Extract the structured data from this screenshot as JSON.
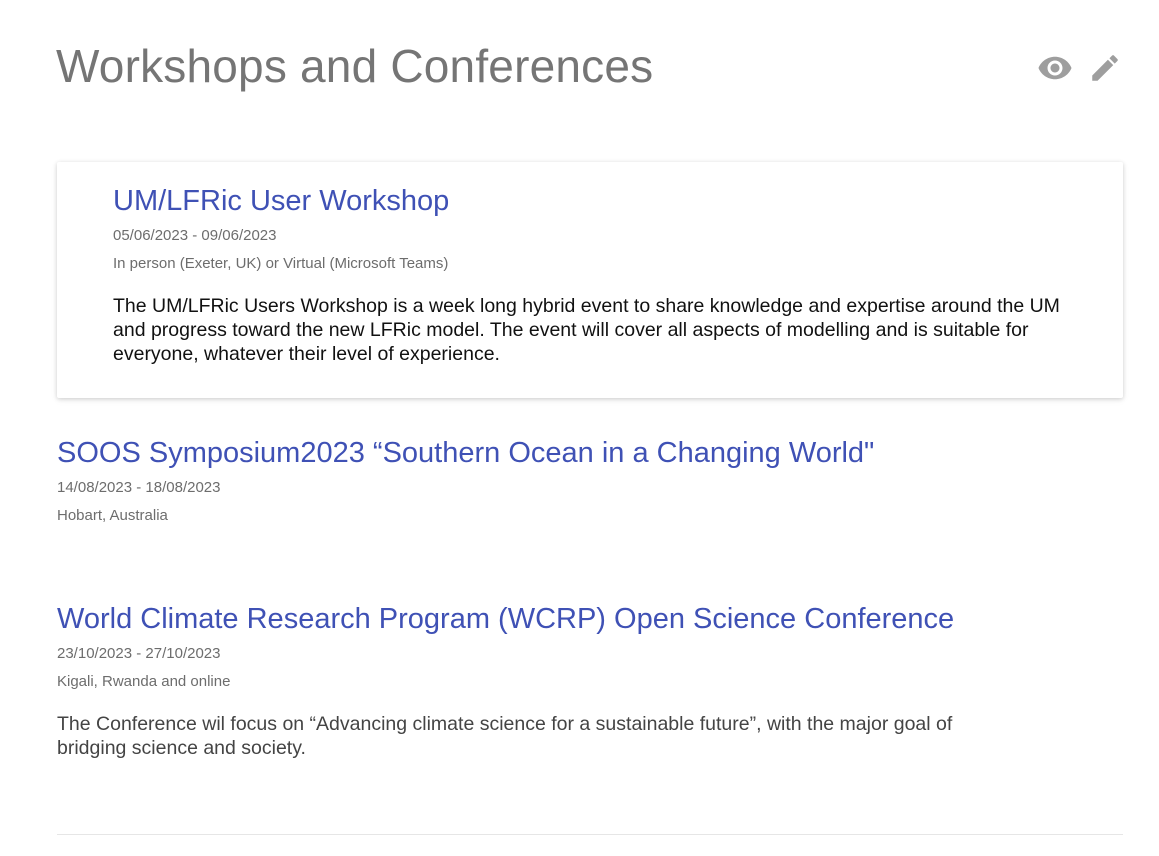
{
  "header": {
    "title": "Workshops and Conferences",
    "view_icon": "eye-icon",
    "edit_icon": "pencil-icon"
  },
  "events": [
    {
      "title": "UM/LFRic User Workshop",
      "dates": "05/06/2023 - 09/06/2023",
      "location": "In person (Exeter, UK) or Virtual (Microsoft Teams)",
      "description": "The UM/LFRic Users Workshop is a week long hybrid event to share knowledge and expertise around the UM and progress toward the new LFRic model. The event will cover all aspects of modelling and is suitable for everyone, whatever their level of experience."
    },
    {
      "title": "SOOS Symposium2023 “Southern Ocean in a Changing World\"",
      "dates": "14/08/2023 - 18/08/2023",
      "location": "Hobart, Australia"
    },
    {
      "title": "World Climate Research Program (WCRP) Open Science Conference",
      "dates": "23/10/2023 - 27/10/2023",
      "location": "Kigali, Rwanda and online",
      "description": "The Conference wil focus on “Advancing climate science for a sustainable future”, with the major goal of bridging science and society."
    }
  ],
  "colors": {
    "link": "#3f51b5",
    "title": "#757575",
    "icon": "#9e9e9e"
  }
}
